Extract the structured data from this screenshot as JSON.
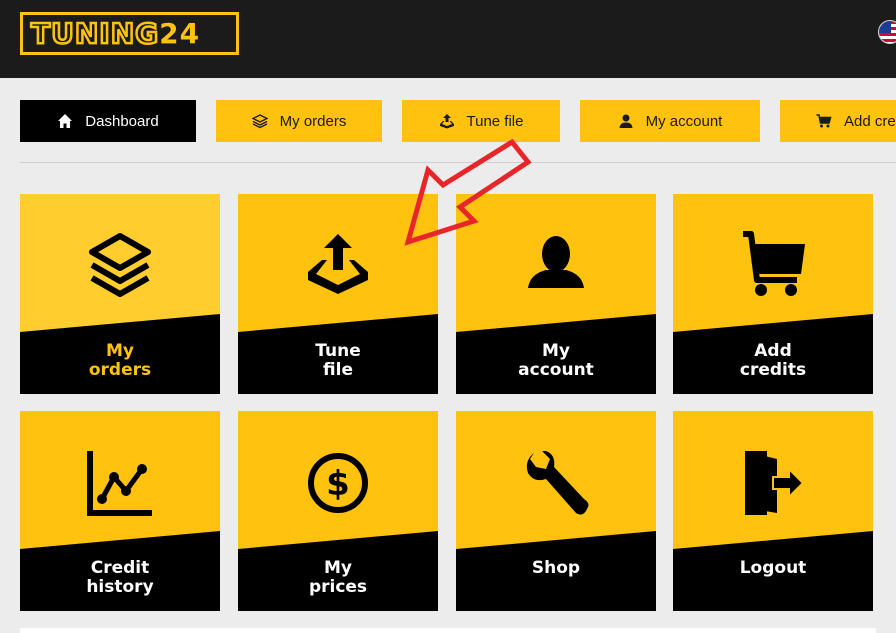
{
  "header": {
    "logo": {
      "main": "TUNING",
      "number": "24"
    },
    "language_flag_icon": "us-flag-icon"
  },
  "nav": [
    {
      "label": "Dashboard",
      "icon": "home-icon",
      "active": true
    },
    {
      "label": "My orders",
      "icon": "layers-icon",
      "active": false
    },
    {
      "label": "Tune file",
      "icon": "upload-tray-icon",
      "active": false
    },
    {
      "label": "My account",
      "icon": "user-icon",
      "active": false
    },
    {
      "label": "Add cre",
      "icon": "cart-icon",
      "active": false
    }
  ],
  "tiles": [
    {
      "line1": "My",
      "line2": "orders",
      "icon": "layers-icon"
    },
    {
      "line1": "Tune",
      "line2": "file",
      "icon": "upload-tray-icon"
    },
    {
      "line1": "My",
      "line2": "account",
      "icon": "user-icon"
    },
    {
      "line1": "Add",
      "line2": "credits",
      "icon": "cart-icon"
    },
    {
      "line1": "Credit",
      "line2": "history",
      "icon": "line-chart-icon"
    },
    {
      "line1": "My",
      "line2": "prices",
      "icon": "dollar-coin-icon"
    },
    {
      "line1": "Shop",
      "line2": "",
      "icon": "wrench-icon"
    },
    {
      "line1": "Logout",
      "line2": "",
      "icon": "logout-door-icon"
    }
  ],
  "colors": {
    "accent": "#ffc20e",
    "header_bg": "#1b1b1b",
    "tile_dark": "#000000",
    "arrow": "#e8262a"
  }
}
